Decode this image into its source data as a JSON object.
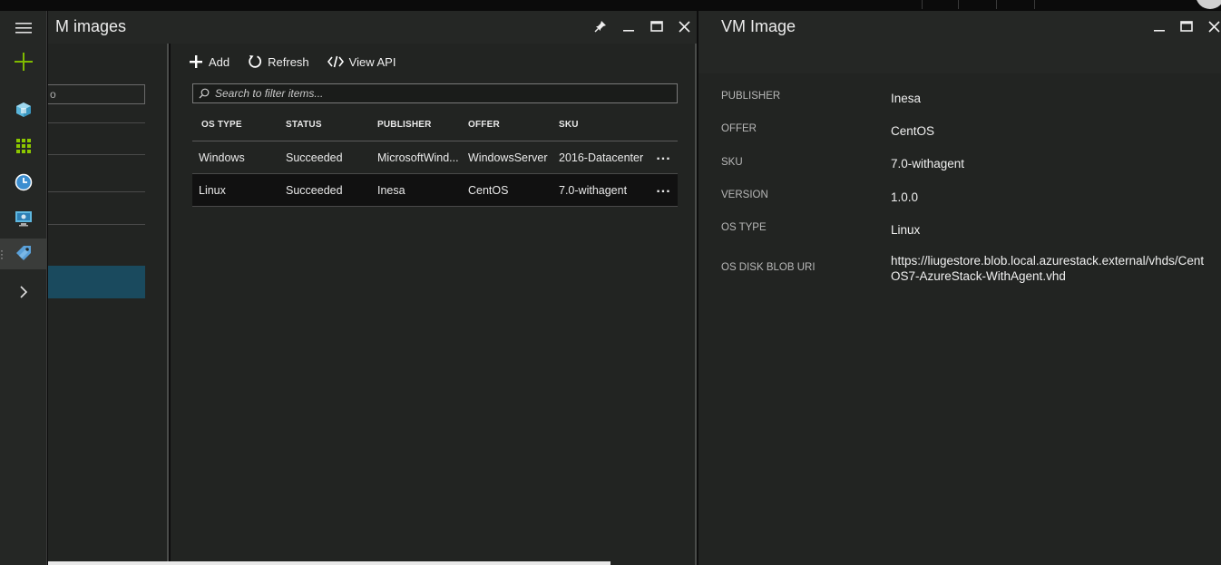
{
  "sidebar": {
    "items": [
      {
        "icon": "hamburger-menu-icon"
      },
      {
        "icon": "new-plus-icon"
      },
      {
        "icon": "resource-cube-icon"
      },
      {
        "icon": "all-resources-grid-icon"
      },
      {
        "icon": "recent-clock-icon"
      },
      {
        "icon": "virtual-machine-icon"
      },
      {
        "icon": "tag-icon"
      },
      {
        "icon": "chevron-right-icon"
      }
    ]
  },
  "list_blade": {
    "search_fragment": "o"
  },
  "vm_blade": {
    "title": "M images",
    "controls": {
      "pin": "pin",
      "minimize": "minimize",
      "maximize": "maximize",
      "close": "close"
    },
    "commands": {
      "add": "Add",
      "refresh": "Refresh",
      "view_api": "View API"
    },
    "search_placeholder": "Search to filter items...",
    "columns": [
      "OS TYPE",
      "STATUS",
      "PUBLISHER",
      "OFFER",
      "SKU"
    ],
    "rows": [
      {
        "os_type": "Windows",
        "status": "Succeeded",
        "publisher": "MicrosoftWind...",
        "offer": "WindowsServer",
        "sku": "2016-Datacenter",
        "more": "..."
      },
      {
        "os_type": "Linux",
        "status": "Succeeded",
        "publisher": "Inesa",
        "offer": "CentOS",
        "sku": "7.0-withagent",
        "more": "..."
      }
    ]
  },
  "detail_blade": {
    "title": "VM Image",
    "properties": [
      {
        "label": "PUBLISHER",
        "value": "Inesa"
      },
      {
        "label": "OFFER",
        "value": "CentOS"
      },
      {
        "label": "SKU",
        "value": "7.0-withagent"
      },
      {
        "label": "VERSION",
        "value": "1.0.0"
      },
      {
        "label": "OS TYPE",
        "value": "Linux"
      },
      {
        "label": "OS DISK BLOB URI",
        "value": "https://liugestore.blob.local.azurestack.external/vhds/CentOS7-AzureStack-WithAgent.vhd"
      }
    ]
  },
  "colors": {
    "accent_green": "#7fba00",
    "selected_blue": "#1a4a5e",
    "blade_bg": "#222422"
  }
}
